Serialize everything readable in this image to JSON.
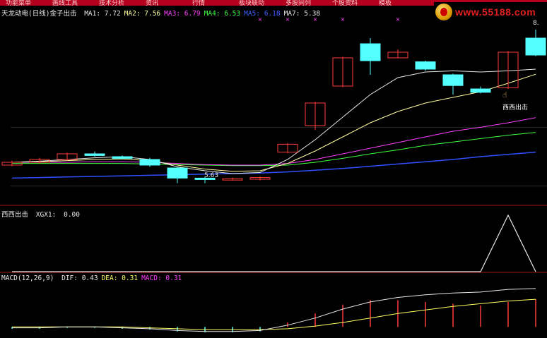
{
  "menu": [
    "功能菜单",
    "画线工具",
    "技术分析",
    "资讯",
    "行情",
    "板块联动",
    "多股同列",
    "个股资料",
    "模板"
  ],
  "logo": {
    "text": "www.55188.com"
  },
  "main_legend": {
    "title": "天龙动电(日线)金子出击",
    "items": [
      {
        "label": "MA1",
        "value": "7.72",
        "color": "#e8e8e8"
      },
      {
        "label": "MA2",
        "value": "7.56",
        "color": "#ffffa0"
      },
      {
        "label": "MA3",
        "value": "6.79",
        "color": "#ff40ff"
      },
      {
        "label": "MA4",
        "value": "6.53",
        "color": "#40ff40"
      },
      {
        "label": "MA5",
        "value": "6.18",
        "color": "#4060ff"
      },
      {
        "label": "MA7",
        "value": "5.38",
        "color": "#e8e8e8"
      }
    ]
  },
  "price_labels": {
    "high": "8.",
    "low": "5.63",
    "signal": "西西出击"
  },
  "mid_legend": {
    "title": "西西出击",
    "item": "XGX1",
    "value": "0.00"
  },
  "macd_legend": {
    "title": "MACD(12,26,9)",
    "items": [
      {
        "label": "DIF",
        "value": "0.43",
        "color": "#e8e8e8"
      },
      {
        "label": "DEA",
        "value": "0.31",
        "color": "#ffff60"
      },
      {
        "label": "MACD",
        "value": "0.31",
        "color": "#ff40ff"
      }
    ]
  },
  "colors": {
    "up": "#ff3b3b",
    "down": "#54ffff",
    "panel_border": "#a01818",
    "ma1": "#e8e8e8",
    "ma2": "#ffffa0",
    "ma3": "#ff40ff",
    "ma4": "#40ff40",
    "ma5": "#3050ff"
  },
  "chart_data": [
    {
      "type": "candlestick",
      "candles": [
        {
          "open": 5.95,
          "close": 6.0,
          "high": 6.03,
          "low": 5.93
        },
        {
          "open": 6.0,
          "close": 6.05,
          "high": 6.08,
          "low": 5.98
        },
        {
          "open": 6.05,
          "close": 6.15,
          "high": 6.17,
          "low": 6.03
        },
        {
          "open": 6.15,
          "close": 6.12,
          "high": 6.19,
          "low": 6.1
        },
        {
          "open": 6.1,
          "close": 6.07,
          "high": 6.12,
          "low": 6.05
        },
        {
          "open": 6.05,
          "close": 5.95,
          "high": 6.08,
          "low": 5.92
        },
        {
          "open": 5.9,
          "close": 5.72,
          "high": 5.92,
          "low": 5.63
        },
        {
          "open": 5.72,
          "close": 5.7,
          "high": 5.74,
          "low": 5.63
        },
        {
          "open": 5.7,
          "close": 5.71,
          "high": 5.73,
          "low": 5.68
        },
        {
          "open": 5.7,
          "close": 5.73,
          "high": 5.75,
          "low": 5.68
        },
        {
          "open": 6.18,
          "close": 6.32,
          "high": 6.34,
          "low": 6.16
        },
        {
          "open": 6.65,
          "close": 7.05,
          "high": 7.07,
          "low": 6.57
        },
        {
          "open": 7.35,
          "close": 7.85,
          "high": 7.87,
          "low": 7.33
        },
        {
          "open": 8.1,
          "close": 7.8,
          "high": 8.2,
          "low": 7.55
        },
        {
          "open": 7.85,
          "close": 7.95,
          "high": 8.0,
          "low": 7.85
        },
        {
          "open": 7.78,
          "close": 7.65,
          "high": 7.8,
          "low": 7.62
        },
        {
          "open": 7.55,
          "close": 7.36,
          "high": 7.57,
          "low": 7.2
        },
        {
          "open": 7.3,
          "close": 7.24,
          "high": 7.34,
          "low": 7.22
        },
        {
          "open": 7.32,
          "close": 7.95,
          "high": 7.97,
          "low": 7.3
        },
        {
          "open": 8.2,
          "close": 7.9,
          "high": 8.35,
          "low": 7.88
        }
      ],
      "ma1": [
        6.0,
        6.02,
        6.05,
        6.08,
        6.1,
        6.05,
        5.92,
        5.85,
        5.8,
        5.82,
        6.05,
        6.4,
        6.8,
        7.2,
        7.5,
        7.6,
        7.62,
        7.6,
        7.62,
        7.65
      ],
      "ma2": [
        6.0,
        6.01,
        6.03,
        6.05,
        6.06,
        6.03,
        5.95,
        5.88,
        5.84,
        5.85,
        5.98,
        6.2,
        6.45,
        6.7,
        6.9,
        7.05,
        7.15,
        7.25,
        7.4,
        7.56
      ],
      "ma3": [
        6.0,
        6.0,
        6.0,
        6.01,
        6.01,
        6.0,
        5.98,
        5.96,
        5.95,
        5.95,
        5.98,
        6.05,
        6.15,
        6.25,
        6.35,
        6.45,
        6.55,
        6.62,
        6.7,
        6.79
      ],
      "ma4": [
        5.98,
        5.98,
        5.98,
        5.98,
        5.98,
        5.97,
        5.96,
        5.95,
        5.94,
        5.94,
        5.95,
        6.0,
        6.07,
        6.15,
        6.22,
        6.3,
        6.36,
        6.42,
        6.48,
        6.53
      ],
      "ma5": [
        5.72,
        5.73,
        5.74,
        5.75,
        5.76,
        5.77,
        5.78,
        5.79,
        5.8,
        5.81,
        5.83,
        5.86,
        5.89,
        5.93,
        5.97,
        6.01,
        6.05,
        6.1,
        6.14,
        6.18
      ],
      "ylim": [
        5.3,
        8.6
      ]
    },
    {
      "type": "line",
      "title": "西西出击",
      "xgx1": [
        0,
        0,
        0,
        0,
        0,
        0,
        0,
        0,
        0,
        0,
        0,
        0,
        0,
        0,
        0,
        0,
        0,
        0,
        1,
        0
      ]
    },
    {
      "type": "bar",
      "title": "MACD(12,26,9)",
      "macd": [
        -0.02,
        -0.02,
        -0.01,
        -0.01,
        -0.02,
        -0.03,
        -0.05,
        -0.06,
        -0.06,
        -0.05,
        0.05,
        0.15,
        0.25,
        0.3,
        0.3,
        0.28,
        0.26,
        0.24,
        0.28,
        0.31
      ],
      "dif": [
        -0.01,
        -0.01,
        0.0,
        0.0,
        -0.01,
        -0.02,
        -0.04,
        -0.05,
        -0.05,
        -0.04,
        0.02,
        0.1,
        0.2,
        0.28,
        0.33,
        0.36,
        0.38,
        0.39,
        0.42,
        0.43
      ],
      "dea": [
        0.0,
        0.0,
        0.0,
        0.0,
        0.0,
        -0.01,
        -0.02,
        -0.03,
        -0.03,
        -0.03,
        -0.02,
        0.01,
        0.05,
        0.1,
        0.15,
        0.19,
        0.23,
        0.26,
        0.29,
        0.31
      ],
      "ylim": [
        -0.1,
        0.5
      ]
    }
  ]
}
